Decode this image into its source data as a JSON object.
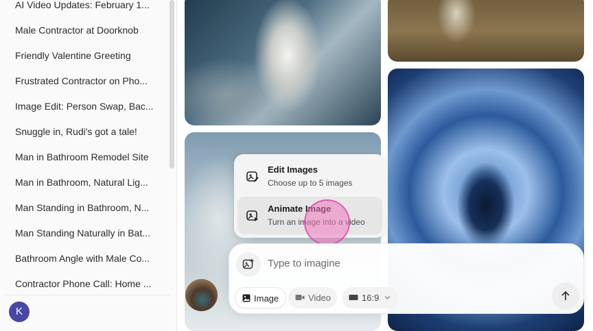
{
  "sidebar": {
    "items": [
      {
        "label": "AI Video Updates: February 1..."
      },
      {
        "label": "Male Contractor at Doorknob"
      },
      {
        "label": "Friendly Valentine Greeting"
      },
      {
        "label": "Frustrated Contractor on Pho..."
      },
      {
        "label": "Image Edit: Person Swap, Bac..."
      },
      {
        "label": "Snuggle in, Rudi's got a tale!"
      },
      {
        "label": "Man in Bathroom Remodel Site"
      },
      {
        "label": "Man in Bathroom, Natural Lig..."
      },
      {
        "label": "Man Standing in Bathroom, N..."
      },
      {
        "label": "Man Standing Naturally in Bat..."
      },
      {
        "label": "Bathroom Angle with Male Co..."
      },
      {
        "label": "Contractor Phone Call: Home ..."
      }
    ],
    "avatar_initial": "K"
  },
  "menu": {
    "edit_title": "Edit Images",
    "edit_subtitle": "Choose up to 5 images",
    "animate_title": "Animate Image",
    "animate_subtitle": "Turn an image into a video"
  },
  "composer": {
    "placeholder": "Type to imagine",
    "mode_image": "Image",
    "mode_video": "Video",
    "aspect_ratio": "16:9"
  },
  "colors": {
    "avatar_bg": "#4a46a6",
    "cursor_highlight": "#f078be"
  }
}
